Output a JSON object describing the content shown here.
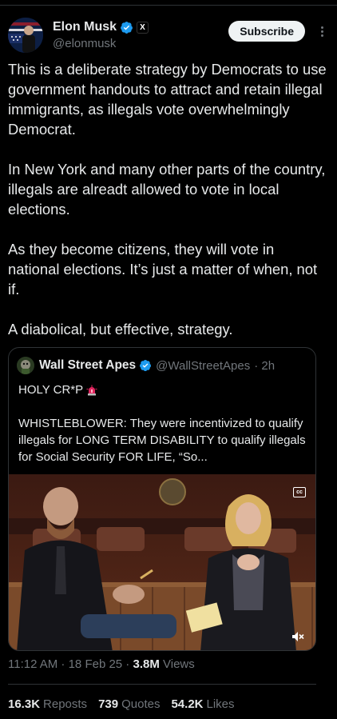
{
  "author": {
    "display_name": "Elon Musk",
    "handle": "@elonmusk",
    "x_badge": "X"
  },
  "actions": {
    "subscribe_label": "Subscribe"
  },
  "tweet": {
    "paragraphs": [
      "This is a deliberate strategy by Democrats to use government handouts to attract and retain illegal immigrants, as illegals vote overwhelmingly Democrat.",
      "In New York and many other parts of the country, illegals are alreadt allowed to vote in local elections.",
      "As they become citizens, they will vote in national elections. It’s just a matter of when, not if.",
      "A diabolical, but effective, strategy."
    ]
  },
  "quote": {
    "display_name": "Wall Street Apes",
    "handle": "@WallStreetApes",
    "time": "· 2h",
    "line1": "HOLY CR*P",
    "body": "WHISTLEBLOWER: They were incentivized to qualify illegals for LONG TERM DISABILITY to qualify illegals for Social Security FOR LIFE, “So...",
    "video": {
      "cc_label": "cc",
      "mute_icon": "mute-icon"
    }
  },
  "meta": {
    "time": "11:12 AM · 18 Feb 25 · ",
    "views_count": "3.8M",
    "views_label": " Views"
  },
  "stats": {
    "reposts_count": "16.3K",
    "reposts_label": "Reposts",
    "quotes_count": "739",
    "quotes_label": "Quotes",
    "likes_count": "54.2K",
    "likes_label": "Likes"
  },
  "colors": {
    "background": "#000000",
    "text": "#e7e9ea",
    "muted": "#71767b",
    "verified_blue": "#1d9bf0",
    "border": "#2f3336"
  }
}
